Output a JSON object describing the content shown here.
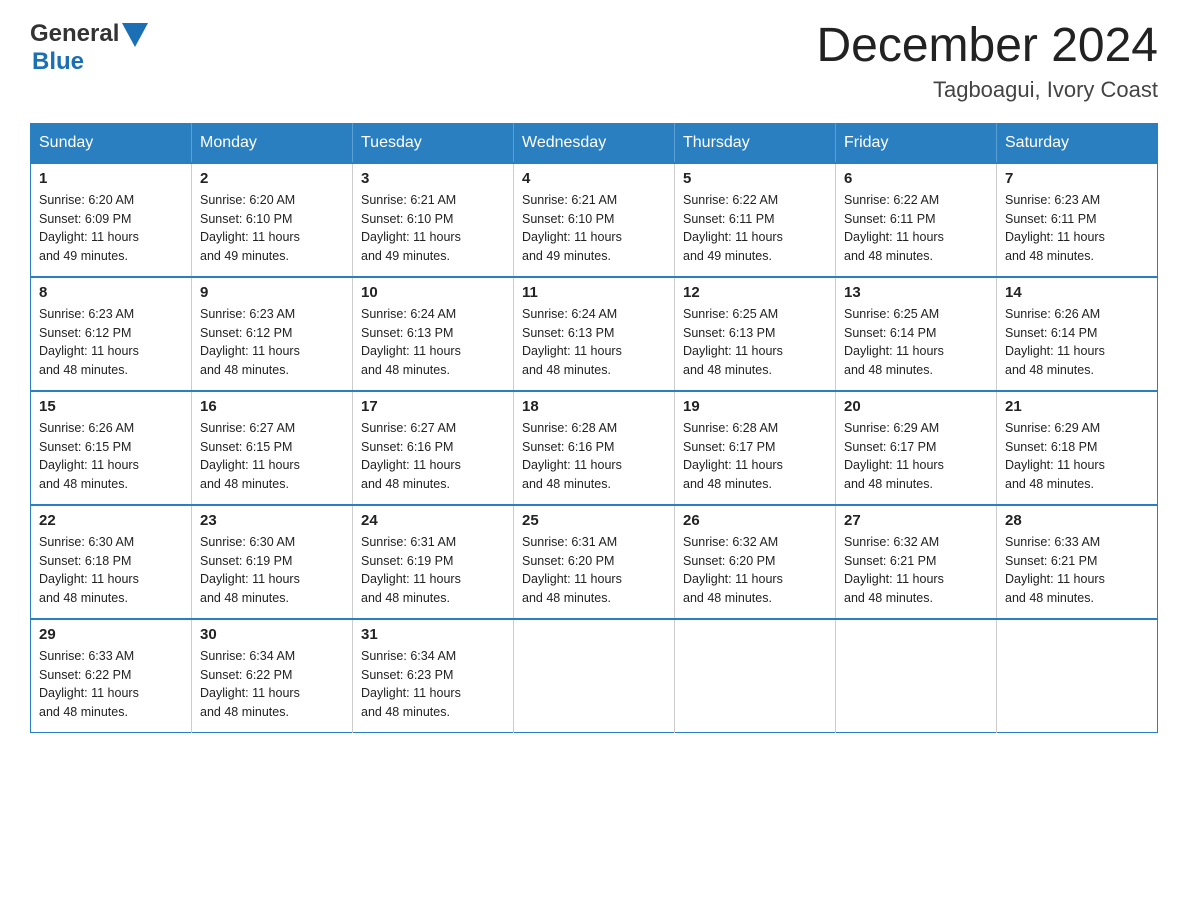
{
  "header": {
    "logo_general": "General",
    "logo_blue": "Blue",
    "month_title": "December 2024",
    "subtitle": "Tagboagui, Ivory Coast"
  },
  "weekdays": [
    "Sunday",
    "Monday",
    "Tuesday",
    "Wednesday",
    "Thursday",
    "Friday",
    "Saturday"
  ],
  "weeks": [
    [
      {
        "day": "1",
        "sunrise": "6:20 AM",
        "sunset": "6:09 PM",
        "daylight": "11 hours and 49 minutes."
      },
      {
        "day": "2",
        "sunrise": "6:20 AM",
        "sunset": "6:10 PM",
        "daylight": "11 hours and 49 minutes."
      },
      {
        "day": "3",
        "sunrise": "6:21 AM",
        "sunset": "6:10 PM",
        "daylight": "11 hours and 49 minutes."
      },
      {
        "day": "4",
        "sunrise": "6:21 AM",
        "sunset": "6:10 PM",
        "daylight": "11 hours and 49 minutes."
      },
      {
        "day": "5",
        "sunrise": "6:22 AM",
        "sunset": "6:11 PM",
        "daylight": "11 hours and 49 minutes."
      },
      {
        "day": "6",
        "sunrise": "6:22 AM",
        "sunset": "6:11 PM",
        "daylight": "11 hours and 48 minutes."
      },
      {
        "day": "7",
        "sunrise": "6:23 AM",
        "sunset": "6:11 PM",
        "daylight": "11 hours and 48 minutes."
      }
    ],
    [
      {
        "day": "8",
        "sunrise": "6:23 AM",
        "sunset": "6:12 PM",
        "daylight": "11 hours and 48 minutes."
      },
      {
        "day": "9",
        "sunrise": "6:23 AM",
        "sunset": "6:12 PM",
        "daylight": "11 hours and 48 minutes."
      },
      {
        "day": "10",
        "sunrise": "6:24 AM",
        "sunset": "6:13 PM",
        "daylight": "11 hours and 48 minutes."
      },
      {
        "day": "11",
        "sunrise": "6:24 AM",
        "sunset": "6:13 PM",
        "daylight": "11 hours and 48 minutes."
      },
      {
        "day": "12",
        "sunrise": "6:25 AM",
        "sunset": "6:13 PM",
        "daylight": "11 hours and 48 minutes."
      },
      {
        "day": "13",
        "sunrise": "6:25 AM",
        "sunset": "6:14 PM",
        "daylight": "11 hours and 48 minutes."
      },
      {
        "day": "14",
        "sunrise": "6:26 AM",
        "sunset": "6:14 PM",
        "daylight": "11 hours and 48 minutes."
      }
    ],
    [
      {
        "day": "15",
        "sunrise": "6:26 AM",
        "sunset": "6:15 PM",
        "daylight": "11 hours and 48 minutes."
      },
      {
        "day": "16",
        "sunrise": "6:27 AM",
        "sunset": "6:15 PM",
        "daylight": "11 hours and 48 minutes."
      },
      {
        "day": "17",
        "sunrise": "6:27 AM",
        "sunset": "6:16 PM",
        "daylight": "11 hours and 48 minutes."
      },
      {
        "day": "18",
        "sunrise": "6:28 AM",
        "sunset": "6:16 PM",
        "daylight": "11 hours and 48 minutes."
      },
      {
        "day": "19",
        "sunrise": "6:28 AM",
        "sunset": "6:17 PM",
        "daylight": "11 hours and 48 minutes."
      },
      {
        "day": "20",
        "sunrise": "6:29 AM",
        "sunset": "6:17 PM",
        "daylight": "11 hours and 48 minutes."
      },
      {
        "day": "21",
        "sunrise": "6:29 AM",
        "sunset": "6:18 PM",
        "daylight": "11 hours and 48 minutes."
      }
    ],
    [
      {
        "day": "22",
        "sunrise": "6:30 AM",
        "sunset": "6:18 PM",
        "daylight": "11 hours and 48 minutes."
      },
      {
        "day": "23",
        "sunrise": "6:30 AM",
        "sunset": "6:19 PM",
        "daylight": "11 hours and 48 minutes."
      },
      {
        "day": "24",
        "sunrise": "6:31 AM",
        "sunset": "6:19 PM",
        "daylight": "11 hours and 48 minutes."
      },
      {
        "day": "25",
        "sunrise": "6:31 AM",
        "sunset": "6:20 PM",
        "daylight": "11 hours and 48 minutes."
      },
      {
        "day": "26",
        "sunrise": "6:32 AM",
        "sunset": "6:20 PM",
        "daylight": "11 hours and 48 minutes."
      },
      {
        "day": "27",
        "sunrise": "6:32 AM",
        "sunset": "6:21 PM",
        "daylight": "11 hours and 48 minutes."
      },
      {
        "day": "28",
        "sunrise": "6:33 AM",
        "sunset": "6:21 PM",
        "daylight": "11 hours and 48 minutes."
      }
    ],
    [
      {
        "day": "29",
        "sunrise": "6:33 AM",
        "sunset": "6:22 PM",
        "daylight": "11 hours and 48 minutes."
      },
      {
        "day": "30",
        "sunrise": "6:34 AM",
        "sunset": "6:22 PM",
        "daylight": "11 hours and 48 minutes."
      },
      {
        "day": "31",
        "sunrise": "6:34 AM",
        "sunset": "6:23 PM",
        "daylight": "11 hours and 48 minutes."
      },
      null,
      null,
      null,
      null
    ]
  ],
  "labels": {
    "sunrise_prefix": "Sunrise: ",
    "sunset_prefix": "Sunset: ",
    "daylight_prefix": "Daylight: "
  }
}
